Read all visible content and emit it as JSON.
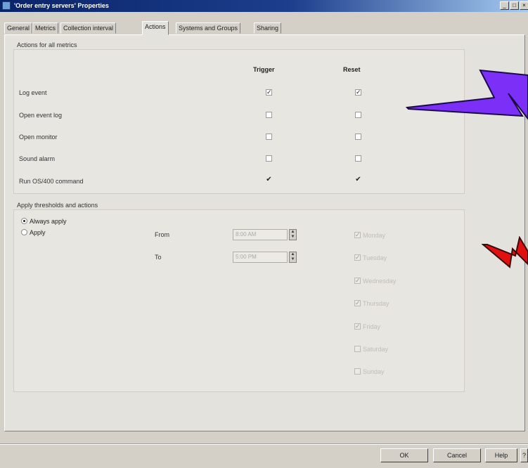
{
  "window": {
    "title": "'Order entry servers' Properties",
    "controls": {
      "minimize": "_",
      "maximize": "□",
      "close": "×"
    }
  },
  "tabs": [
    {
      "label": "General"
    },
    {
      "label": "Metrics"
    },
    {
      "label": "Collection interval"
    },
    {
      "label": "Actions",
      "active": true
    },
    {
      "label": "Systems and Groups"
    },
    {
      "label": "Sharing"
    }
  ],
  "actions_group": {
    "title": "Actions for all metrics",
    "col_trigger": "Trigger",
    "col_reset": "Reset",
    "rows": [
      {
        "label": "Log event",
        "trigger": "checked",
        "reset": "checked"
      },
      {
        "label": "Open event log",
        "trigger": "unchecked",
        "reset": "unchecked"
      },
      {
        "label": "Open monitor",
        "trigger": "unchecked",
        "reset": "unchecked"
      },
      {
        "label": "Sound alarm",
        "trigger": "unchecked",
        "reset": "unchecked"
      },
      {
        "label": "Run OS/400 command",
        "trigger": "check-mark",
        "reset": "check-mark"
      }
    ]
  },
  "apply_group": {
    "title": "Apply thresholds and actions",
    "always_apply": "Always apply",
    "apply": "Apply",
    "selected": "always_apply",
    "from_label": "From",
    "from_value": "8:00 AM",
    "to_label": "To",
    "to_value": "5:00 PM",
    "days": [
      {
        "label": "Monday",
        "checked": true
      },
      {
        "label": "Tuesday",
        "checked": true
      },
      {
        "label": "Wednesday",
        "checked": true
      },
      {
        "label": "Thursday",
        "checked": true
      },
      {
        "label": "Friday",
        "checked": true
      },
      {
        "label": "Saturday",
        "checked": false
      },
      {
        "label": "Sunday",
        "checked": false
      }
    ]
  },
  "buttons": {
    "ok": "OK",
    "cancel": "Cancel",
    "help": "Help",
    "whats_this": "?"
  },
  "colors": {
    "title_start": "#0a246a",
    "title_end": "#a6caf0",
    "lightning_purple": "#7b2ff7",
    "lightning_red": "#e01010"
  }
}
